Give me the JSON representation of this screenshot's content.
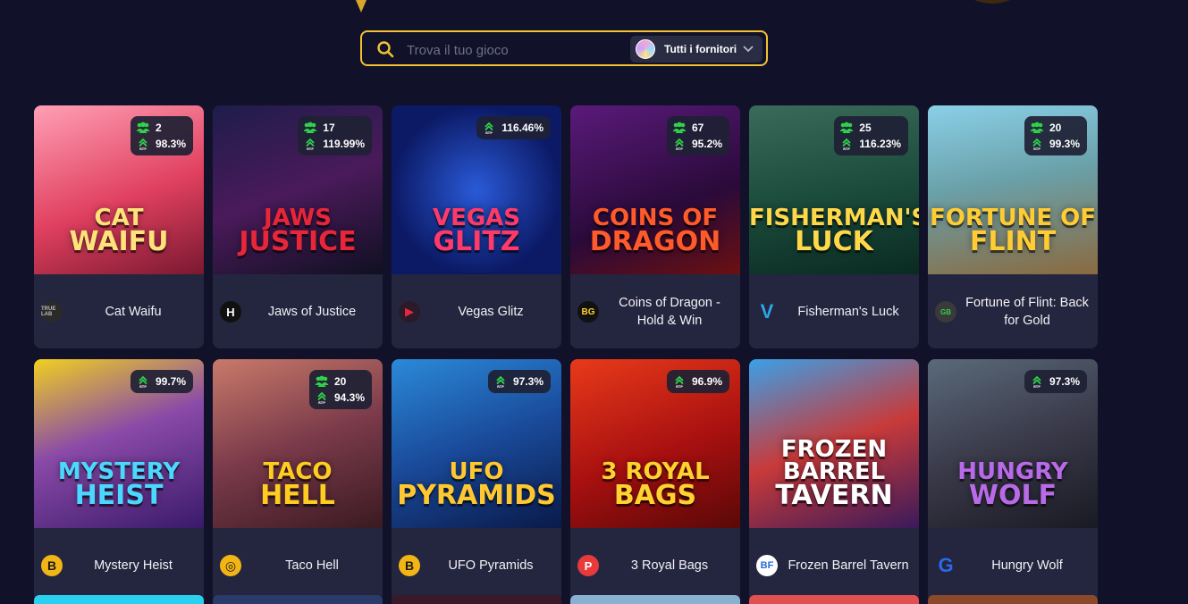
{
  "search": {
    "placeholder": "Trova il tuo gioco",
    "provider_filter_label": "Tutti i fornitori"
  },
  "colors": {
    "background": "#11122a",
    "card": "#24253e",
    "accent": "#f2c230",
    "players_icon": "#2fd24a"
  },
  "games": [
    {
      "name": "Cat Waifu",
      "players": "2",
      "rtp": "98.3%",
      "logo_l1": "CAT",
      "logo_l2": "WAIFU",
      "provider_icon": "truelab-icon",
      "provider_mark": "TRUE LAB",
      "bg": "linear-gradient(160deg,#ff9fb5,#e0405f 55%,#7a1830)",
      "logo_color": "#ffe27a"
    },
    {
      "name": "Jaws of Justice",
      "players": "17",
      "rtp": "119.99%",
      "logo_l1": "JAWS",
      "logo_l2": "JUSTICE",
      "provider_icon": "hacksaw-icon",
      "provider_mark": "H",
      "bg": "linear-gradient(160deg,#1e1d4a,#4a1a5a 50%,#101022)",
      "logo_color": "#e8263a"
    },
    {
      "name": "Vegas Glitz",
      "players": "",
      "rtp": "116.46%",
      "logo_l1": "VEGAS",
      "logo_l2": "GLITZ",
      "provider_icon": "redtiger-icon",
      "provider_mark": "▶",
      "bg": "radial-gradient(circle at 50% 50%,#2a5ad8,#0c1a66 70%)",
      "logo_color": "#ff3a6a"
    },
    {
      "name": "Coins of Dragon - Hold & Win",
      "players": "67",
      "rtp": "95.2%",
      "logo_l1": "COINS OF",
      "logo_l2": "DRAGON",
      "provider_icon": "bgaming-icon",
      "provider_mark": "BG",
      "bg": "linear-gradient(160deg,#5a1a7a,#2a0a3a 60%,#6a1010)",
      "logo_color": "#ff5a2a"
    },
    {
      "name": "Fisherman's Luck",
      "players": "25",
      "rtp": "116.23%",
      "logo_l1": "FISHERMAN'S",
      "logo_l2": "LUCK",
      "provider_icon": "vibra-icon",
      "provider_mark": "V",
      "bg": "linear-gradient(170deg,#3a6a5a,#1a4a3a 55%,#0a2a22)",
      "logo_color": "#ffd84a"
    },
    {
      "name": "Fortune of Flint: Back for Gold",
      "players": "20",
      "rtp": "99.3%",
      "logo_l1": "FORTUNE OF",
      "logo_l2": "FLINT",
      "provider_icon": "gamebeat-icon",
      "provider_mark": "GB",
      "bg": "linear-gradient(170deg,#8ad0e8,#6aa0a8 45%,#8a6a40)",
      "logo_color": "#ffcc33"
    },
    {
      "name": "Mystery Heist",
      "players": "",
      "rtp": "99.7%",
      "logo_l1": "MYSTERY",
      "logo_l2": "HEIST",
      "provider_icon": "bgaming-b-icon",
      "provider_mark": "B",
      "bg": "linear-gradient(160deg,#f0d020,#8a4aa8 45%,#3a1a6a)",
      "logo_color": "#4ad8ff"
    },
    {
      "name": "Taco Hell",
      "players": "20",
      "rtp": "94.3%",
      "logo_l1": "TACO",
      "logo_l2": "HELL",
      "provider_icon": "provider-swirl-icon",
      "provider_mark": "◎",
      "bg": "linear-gradient(160deg,#c87a6a,#7a3a4a 50%,#3a1a22)",
      "logo_color": "#ffcc22"
    },
    {
      "name": "UFO Pyramids",
      "players": "",
      "rtp": "97.3%",
      "logo_l1": "UFO",
      "logo_l2": "PYRAMIDS",
      "provider_icon": "bgaming-b-icon",
      "provider_mark": "B",
      "bg": "linear-gradient(160deg,#2a8ad8,#1a4a9a 50%,#0a1a4a)",
      "logo_color": "#ffc830"
    },
    {
      "name": "3 Royal Bags",
      "players": "",
      "rtp": "96.9%",
      "logo_l1": "3 ROYAL",
      "logo_l2": "BAGS",
      "provider_icon": "playson-icon",
      "provider_mark": "P",
      "bg": "linear-gradient(160deg,#e83a1a,#a81010 55%,#5a0808)",
      "logo_color": "#ffd230"
    },
    {
      "name": "Frozen Barrel Tavern",
      "players": "",
      "rtp": "",
      "logo_l1": "FROZEN BARREL",
      "logo_l2": "TAVERN",
      "provider_icon": "bf-icon",
      "provider_mark": "BF",
      "bg": "linear-gradient(160deg,#3aa0e8,#c83a3a 50%,#3a1a5a)",
      "logo_color": "#ffffff"
    },
    {
      "name": "Hungry Wolf",
      "players": "",
      "rtp": "97.3%",
      "logo_l1": "HUNGRY",
      "logo_l2": "WOLF",
      "provider_icon": "gamzix-icon",
      "provider_mark": "G",
      "bg": "linear-gradient(160deg,#5a6a7a,#3a3a4a 50%,#1a1a24)",
      "logo_color": "#b86ae8"
    }
  ]
}
